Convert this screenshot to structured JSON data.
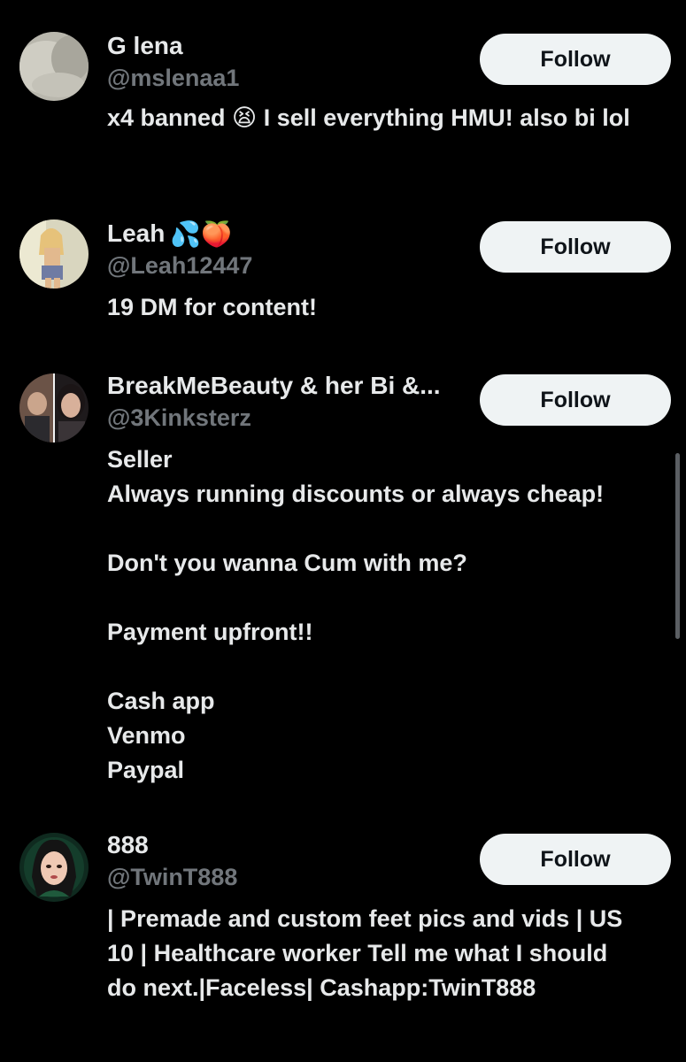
{
  "colors": {
    "background": "#000000",
    "primary_text": "#e7e9ea",
    "secondary_text": "#71767b",
    "follow_button_bg": "#eff3f4",
    "follow_button_text": "#0f1419"
  },
  "users": [
    {
      "display_name": "G lena",
      "handle": "@mslenaa1",
      "follow_label": "Follow",
      "bio_parts": {
        "before_emoji": "x4 banned ",
        "emoji": "😫",
        "after_emoji": " I sell everything HMU! also bi lol"
      }
    },
    {
      "display_name": "Leah",
      "name_emojis": "💦🍑",
      "handle": "@Leah12447",
      "follow_label": "Follow",
      "bio": "19 DM for content!"
    },
    {
      "display_name": "BreakMeBeauty & her Bi &...",
      "handle": "@3Kinksterz",
      "follow_label": "Follow",
      "bio": "Seller\nAlways running discounts or always cheap!\n\nDon't you wanna Cum with me?\n\nPayment upfront!!\n\nCash app\nVenmo\nPaypal"
    },
    {
      "display_name": "888",
      "handle": "@TwinT888",
      "follow_label": "Follow",
      "bio": "| Premade and custom feet pics and vids | US 10 | Healthcare worker Tell me what I should do next.|Faceless| Cashapp:TwinT888"
    }
  ]
}
